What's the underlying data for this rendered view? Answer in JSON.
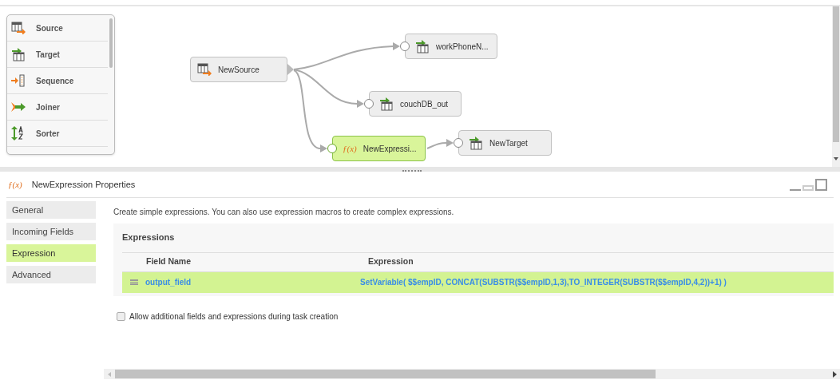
{
  "palette": {
    "items": [
      {
        "label": "Source",
        "kind": "source"
      },
      {
        "label": "Target",
        "kind": "target"
      },
      {
        "label": "Sequence",
        "kind": "sequence"
      },
      {
        "label": "Joiner",
        "kind": "joiner"
      },
      {
        "label": "Sorter",
        "kind": "sorter"
      }
    ]
  },
  "canvas": {
    "nodes": [
      {
        "label": "NewSource",
        "kind": "source",
        "selected": false
      },
      {
        "label": "workPhoneN...",
        "kind": "target",
        "selected": false
      },
      {
        "label": "couchDB_out",
        "kind": "target",
        "selected": false
      },
      {
        "label": "NewExpressi...",
        "kind": "expression",
        "icon": "ƒ(x)",
        "selected": true
      },
      {
        "label": "NewTarget",
        "kind": "target",
        "selected": false
      }
    ]
  },
  "properties": {
    "icon": "ƒ(x)",
    "title": "NewExpression Properties",
    "tabs": [
      {
        "label": "General",
        "selected": false
      },
      {
        "label": "Incoming Fields",
        "selected": false
      },
      {
        "label": "Expression",
        "selected": true
      },
      {
        "label": "Advanced",
        "selected": false
      }
    ],
    "description": "Create simple expressions. You can also use expression macros to create complex expressions.",
    "section_title": "Expressions",
    "table": {
      "columns": [
        "Field Name",
        "Expression"
      ],
      "rows": [
        {
          "field_name": "output_field",
          "expression": "SetVariable( $$empID,  CONCAT(SUBSTR($$empID,1,3),TO_INTEGER(SUBSTR($$empID,4,2))+1) )",
          "selected": true
        }
      ]
    },
    "allow_additional": {
      "label": "Allow additional fields and expressions during task creation",
      "checked": false
    }
  }
}
